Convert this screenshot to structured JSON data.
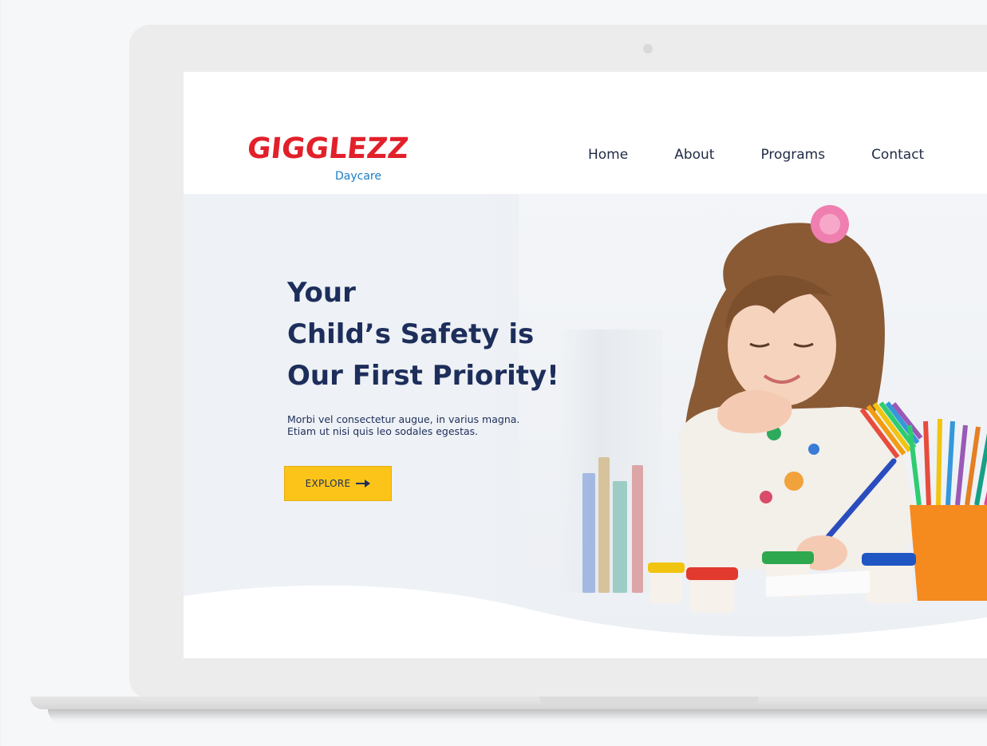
{
  "brand": {
    "name": "GIGGLEZZ",
    "tagline": "Daycare",
    "logo_color": "#e2202a",
    "tagline_color": "#1b7fc4"
  },
  "nav": {
    "items": [
      {
        "label": "Home"
      },
      {
        "label": "About"
      },
      {
        "label": "Programs"
      },
      {
        "label": "Contact"
      }
    ]
  },
  "hero": {
    "headline_lines": [
      "Your",
      "Child’s Safety is",
      "Our First Priority!"
    ],
    "subtext_lines": [
      "Morbi vel consectetur augue, in varius magna.",
      "Etiam ut nisi quis leo sodales egestas."
    ],
    "cta_label": "EXPLORE",
    "cta_icon": "arrow-right-icon",
    "headline_color": "#1d2e5b",
    "cta_color": "#fcc418"
  }
}
